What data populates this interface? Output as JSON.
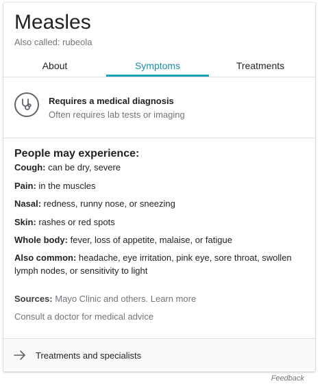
{
  "header": {
    "title": "Measles",
    "subtitle": "Also called: rubeola"
  },
  "tabs": [
    {
      "label": "About"
    },
    {
      "label": "Symptoms"
    },
    {
      "label": "Treatments"
    }
  ],
  "diagnosis": {
    "icon": "stethoscope-icon",
    "title": "Requires a medical diagnosis",
    "subtitle": "Often requires lab tests or imaging"
  },
  "symptoms": {
    "heading": "People may experience:",
    "items": [
      {
        "label": "Cough:",
        "text": "can be dry, severe"
      },
      {
        "label": "Pain:",
        "text": "in the muscles"
      },
      {
        "label": "Nasal:",
        "text": "redness, runny nose, or sneezing"
      },
      {
        "label": "Skin:",
        "text": "rashes or red spots"
      },
      {
        "label": "Whole body:",
        "text": "fever, loss of appetite, malaise, or fatigue"
      },
      {
        "label": "Also common:",
        "text": "headache, eye irritation, pink eye, sore throat, swollen lymph nodes, or sensitivity to light"
      }
    ]
  },
  "sources": {
    "label": "Sources:",
    "text": "Mayo Clinic and others.",
    "link": "Learn more"
  },
  "consult": "Consult a doctor for medical advice",
  "footer": {
    "label": "Treatments and specialists",
    "icon": "arrow-right-icon"
  },
  "feedback": "Feedback",
  "colors": {
    "accent": "#1a9fb8",
    "muted": "#70757a"
  }
}
